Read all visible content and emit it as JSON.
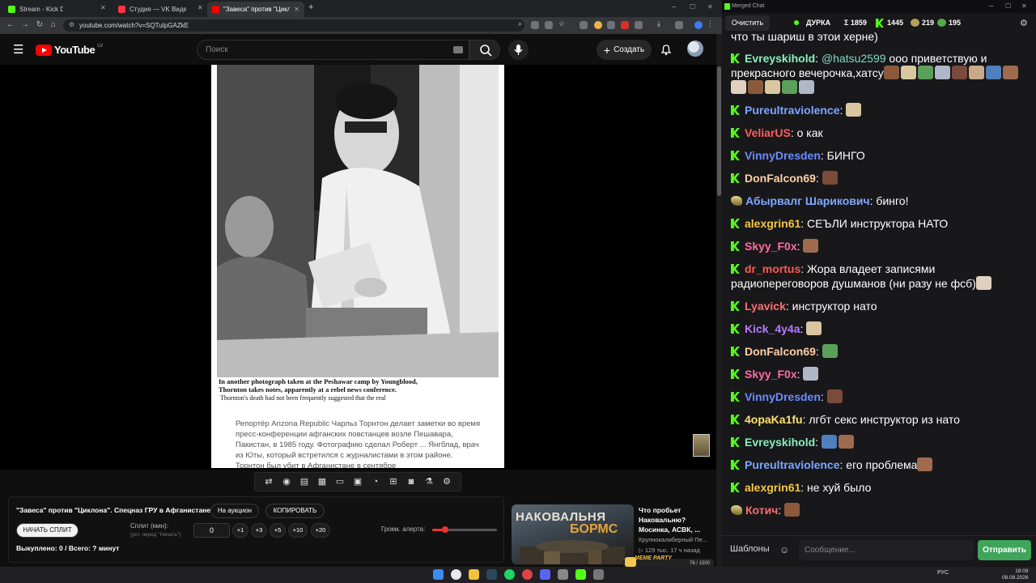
{
  "browser": {
    "tabs": [
      {
        "title": "Stream - Kick Dashboard",
        "color": "#53fc18"
      },
      {
        "title": "Студия — VK Видео Live",
        "color": "#ff3347"
      },
      {
        "title": "\"Завеса\" против \"Циклона\"",
        "color": "#ff0000"
      }
    ],
    "new_tab": "+",
    "url": "youtube.com/watch?v=SQTuIpGAZkE"
  },
  "youtube": {
    "logo": "YouTube",
    "region": "LV",
    "search_placeholder": "Поиск",
    "create_label": "Создать"
  },
  "video": {
    "caption_line1": "In another photograph taken at the Peshawar camp by Youngblood,",
    "caption_line2": "Thornton takes notes, apparently at a rebel news conference.",
    "caption_below": "Thornton's death had not been   frequently suggested that the real",
    "translation": "Репортёр Arizona Republic Чарльз Торнтон делает заметки во время пресс-конференции афганских повстанцев возле Пешавара, Пакистан, в 1985 году. Фотографию сделал Роберт ... Янгблад, врач из Юты, который встретился с журналистами в этом районе. Торнтон был убит в Афганистане в сентябре"
  },
  "toolbar": {
    "icons": [
      "repeat-icon",
      "broadcast-icon",
      "subscriptions-icon",
      "playlist-icon",
      "screen-icon",
      "slides-icon",
      "speed-icon",
      "add-icon",
      "camera-icon",
      "flask-icon",
      "settings-icon"
    ],
    "glyphs": [
      "⇄",
      "◉",
      "▤",
      "▦",
      "▭",
      "▣",
      "◔",
      "⊞",
      "◙",
      "⚗",
      "⚙"
    ]
  },
  "auction_panel": {
    "title": "\"Завеса\" против \"Циклона\". Спецназ ГРУ в Афганистане.",
    "on_auction": "На аукцион",
    "copy": "КОПИРОВАТЬ",
    "start_split": "НАЧАТЬ СПЛИТ",
    "split_label": "Сплит (мин):",
    "split_hint": "(уст. перед \"Начать\")",
    "split_value": "0",
    "steps": [
      "+1",
      "+3",
      "+5",
      "+10",
      "+20"
    ],
    "volume_label": "Громк. алерта:",
    "volume_level": 0.2,
    "bought": "Выкуплено: 0 / Всего: ? минут"
  },
  "recommendation": {
    "thumb_text1": "НАКОВАЛЬНЯ",
    "thumb_text2": "БОРМС",
    "title": "Что пробьет Наковальню? Мосинка, АСВК, ...",
    "channel": "Крупнокалиберный Пе...",
    "meta": "▷ 129 тыс.  17 ч назад"
  },
  "meme_bar": {
    "label": "MEME PARTY",
    "counter": "76 / 1500"
  },
  "chat": {
    "window_title": "Merged Chat",
    "clear": "Очистить",
    "stats": {
      "name": "ДУРКА",
      "sigma": "Σ 1859",
      "kick": "1445",
      "vk": "219",
      "other": "195"
    },
    "top_fragment": "что ты шариш в этои херне)",
    "messages": [
      {
        "user": "Evreyskihold",
        "color": "#86efbb",
        "badge": "kick",
        "mention": "@hatsu2599",
        "text": " ооо приветствую и прекрасного вечерочка,хатсу",
        "emotes": 13
      },
      {
        "user": "Pureultraviolence",
        "color": "#7aa6ff",
        "badge": "kick",
        "text": "",
        "emotes": 1
      },
      {
        "user": "VeliarUS",
        "color": "#ff5c5c",
        "badge": "kick",
        "text": "о как",
        "emotes": 0
      },
      {
        "user": "VinnyDresden",
        "color": "#6b8cff",
        "badge": "kick",
        "text": "БИНГО",
        "emotes": 0
      },
      {
        "user": "DonFalcon69",
        "color": "#ffd0a6",
        "badge": "kick",
        "text": "",
        "emotes": 1
      },
      {
        "user": "Абырвалг Шарикович",
        "color": "#7fa7ff",
        "badge": "vk",
        "text": "бинго!",
        "emotes": 0
      },
      {
        "user": "alexgrin61",
        "color": "#f5c542",
        "badge": "kick",
        "text": "СЕЪЛИ инструктора НАТО",
        "emotes": 0
      },
      {
        "user": "Skyy_F0x",
        "color": "#ff6b9d",
        "badge": "kick",
        "text": "",
        "emotes": 1
      },
      {
        "user": "dr_mortus",
        "color": "#ff5a4f",
        "badge": "kick",
        "text": "Жора владеет записями радиопереговоров душманов (ни разу не фсб)",
        "emotes": 1
      },
      {
        "user": "Lyavick",
        "color": "#ff6f6f",
        "badge": "kick",
        "text": "инструктор нато",
        "emotes": 0
      },
      {
        "user": "Kick_4y4a",
        "color": "#b77bff",
        "badge": "kick",
        "text": "",
        "emotes": 1
      },
      {
        "user": "DonFalcon69",
        "color": "#ffd0a6",
        "badge": "kick",
        "text": "",
        "emotes": 1
      },
      {
        "user": "Skyy_F0x",
        "color": "#ff6b9d",
        "badge": "kick",
        "text": "",
        "emotes": 1
      },
      {
        "user": "VinnyDresden",
        "color": "#6b8cff",
        "badge": "kick",
        "text": "",
        "emotes": 1
      },
      {
        "user": "4opaKa1fu",
        "color": "#ffe26b",
        "badge": "kick",
        "text": "лгбт секс инструктор из нато",
        "emotes": 0
      },
      {
        "user": "Evreyskihold",
        "color": "#86efbb",
        "badge": "kick",
        "text": "",
        "emotes": 2
      },
      {
        "user": "Pureultraviolence",
        "color": "#7aa6ff",
        "badge": "kick",
        "text": "его проблема",
        "emotes": 1
      },
      {
        "user": "alexgrin61",
        "color": "#f5c542",
        "badge": "kick",
        "text": "не хуй было",
        "emotes": 0
      },
      {
        "user": "Котич",
        "color": "#ff6a6a",
        "badge": "vk",
        "text": "",
        "emotes": 1
      }
    ],
    "templates": "Шаблоны",
    "input_placeholder": "Сообщение...",
    "send": "Отправить"
  },
  "taskbar": {
    "lang": "РУС",
    "time": "18:09",
    "date": "08.08.2026"
  }
}
